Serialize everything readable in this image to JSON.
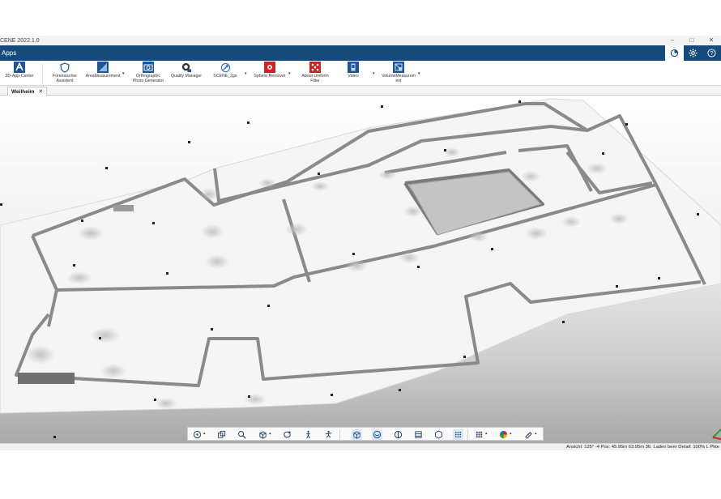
{
  "window": {
    "title": "CENE 2022.1.0",
    "minimize_glyph": "–",
    "maximize_glyph": "□",
    "close_glyph": "✕"
  },
  "ribbon": {
    "tab_label": "Apps",
    "right_icons": [
      "layers-icon",
      "gear-icon",
      "help-icon"
    ]
  },
  "toolbar": {
    "items": [
      {
        "label": "3D-App-Center",
        "icon": "app-center-icon"
      },
      {
        "label": "Forensischer\nAssistent",
        "icon": "shield-icon"
      },
      {
        "label": "AreaMeasurement",
        "icon": "area-measurement-icon"
      },
      {
        "label": "Orthographic\nPhoto Generator",
        "icon": "camera-icon"
      },
      {
        "label": "Quality Manager",
        "icon": "quality-manager-icon"
      },
      {
        "label": "SCENE_2go",
        "icon": "scene2go-icon"
      },
      {
        "label": "Sphere Remover",
        "icon": "sphere-remover-icon"
      },
      {
        "label": "About Uniform\nFilter",
        "icon": "uniform-filter-icon"
      },
      {
        "label": "Video",
        "icon": "video-icon"
      },
      {
        "label": "VolumeMeasurem\nent",
        "icon": "volume-measurement-icon"
      }
    ],
    "dropdown_glyph": "▾"
  },
  "document_tab": {
    "label": "Weilheim",
    "close_glyph": "✕"
  },
  "bottom_toolbar": {
    "icons": [
      "navigation-mode-icon",
      "view-cube-icon",
      "zoom-icon",
      "box-view-icon",
      "rotate-icon",
      "walk-mode-icon",
      "fly-mode-icon",
      "3d-view-icon",
      "sphere-view-icon",
      "clipping-icon",
      "section-icon",
      "hexagon-icon",
      "points-icon",
      "grid-points-icon",
      "color-mode-icon",
      "measure-icon"
    ],
    "dropdown_glyph": "▴"
  },
  "status": {
    "text": "Ansicht: 125° -4 Pos: 45.95m 63.95m 36. Laden beer Detail: 100%  L Pkte"
  },
  "colors": {
    "ribbon_blue": "#174a7c",
    "toolbar_bg": "#ffffff",
    "red_icon": "#c8252b",
    "accent_blue": "#2f6fb3"
  }
}
